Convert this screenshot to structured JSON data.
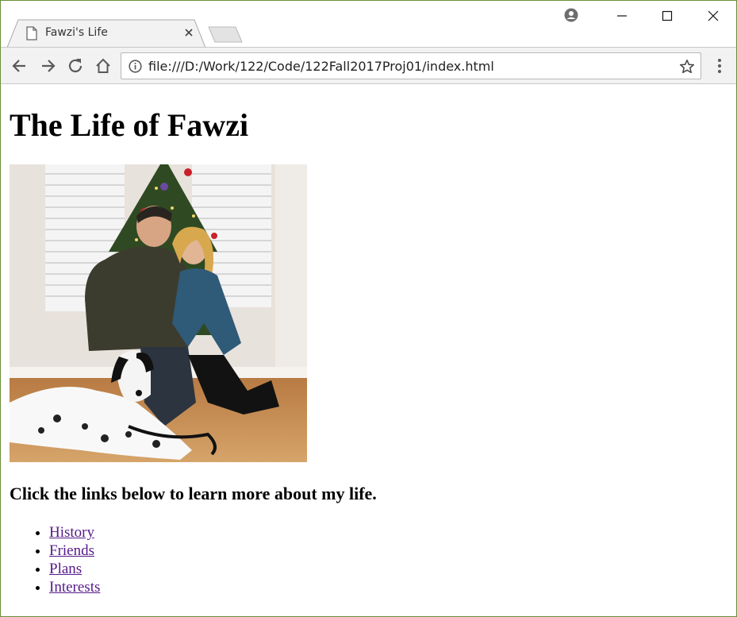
{
  "browser": {
    "tab_title": "Fawzi's Life",
    "url": "file:///D:/Work/122/Code/122Fall2017Proj01/index.html",
    "icons": {
      "favicon": "page-icon",
      "close": "close-icon",
      "new_tab": "new-tab-icon",
      "profile": "profile-icon",
      "minimize": "minimize-icon",
      "maximize": "maximize-icon",
      "window_close": "window-close-icon",
      "back": "back-arrow-icon",
      "forward": "forward-arrow-icon",
      "reload": "reload-icon",
      "home": "home-icon",
      "info": "info-icon",
      "bookmark": "star-icon",
      "menu": "kebab-menu-icon"
    }
  },
  "page": {
    "heading": "The Life of Fawzi",
    "subheading": "Click the links below to learn more about my life.",
    "links": [
      {
        "label": "History"
      },
      {
        "label": "Friends"
      },
      {
        "label": "Plans"
      },
      {
        "label": "Interests"
      }
    ]
  },
  "colors": {
    "visited_link": "#551a8b",
    "window_border": "#6a8f3a",
    "toolbar_bg": "#f2f2f2"
  }
}
